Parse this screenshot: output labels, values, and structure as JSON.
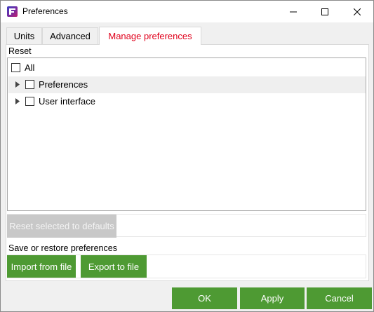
{
  "window": {
    "title": "Preferences",
    "icon": "app-logo-icon",
    "controls": [
      "minimize-icon",
      "maximize-icon",
      "close-icon"
    ]
  },
  "tabs": [
    {
      "label": "Units",
      "active": false
    },
    {
      "label": "Advanced",
      "active": false
    },
    {
      "label": "Manage preferences",
      "active": true
    }
  ],
  "reset_section": {
    "label": "Reset",
    "tree": [
      {
        "label": "All",
        "checked": false,
        "expandable": false
      },
      {
        "label": "Preferences",
        "checked": false,
        "expandable": true,
        "highlighted": true
      },
      {
        "label": "User interface",
        "checked": false,
        "expandable": true
      }
    ],
    "reset_button": "Reset selected to defaults"
  },
  "save_section": {
    "label": "Save or restore preferences",
    "import_button": "Import from file",
    "export_button": "Export to file"
  },
  "footer": {
    "ok": "OK",
    "apply": "Apply",
    "cancel": "Cancel"
  },
  "colors": {
    "accent_green": "#4e9a33",
    "active_tab_text": "#e0001b",
    "disabled_button": "#c8c8c8"
  }
}
